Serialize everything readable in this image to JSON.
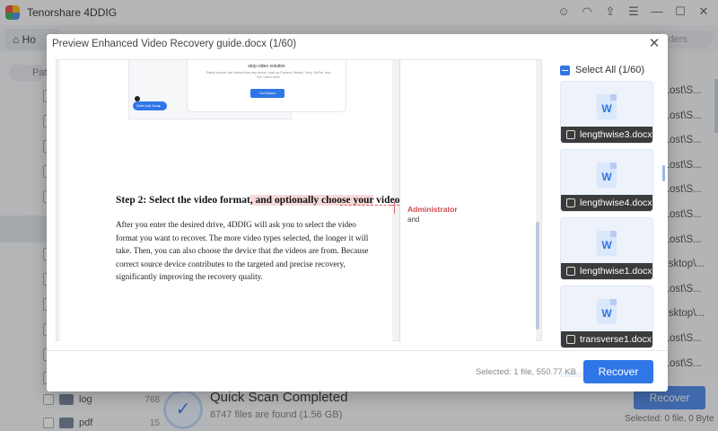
{
  "app": {
    "title": "Tenorshare 4DDIG",
    "home_tab": "Ho",
    "folders_placeholder": "iders",
    "path_chip": "Pat"
  },
  "background": {
    "right_column": [
      "h Lost\\S...",
      "h Lost\\S...",
      "h Lost\\S...",
      "h Lost\\S...",
      "h Lost\\S...",
      "h Lost\\S...",
      "h Lost\\S...",
      "Desktop\\...",
      "h Lost\\S...",
      "Desktop\\...",
      "h Lost\\S...",
      "h Lost\\S..."
    ],
    "tree": [
      {
        "name": "log",
        "count": "768"
      },
      {
        "name": "pdf",
        "count": "15"
      }
    ],
    "scan_title": "Quick Scan Completed",
    "scan_sub": "8747 files are found (1.56 GB)",
    "recover_label": "Recover",
    "selected_text": "Selected: 0 file, 0 Byte"
  },
  "modal": {
    "title": "Preview Enhanced Video Recovery guide.docx (1/60)",
    "doc": {
      "embed_title": "stop video solution",
      "embed_desc": "Easily recover lost videos from any device, such as Camera, Meiser, Sony, GoPro, and DJI. Learn more",
      "embed_button": "Get Started",
      "embed_pill": "Guide Quik Cam ▶",
      "heading_a": "Step 2: Select the video format",
      "heading_b": ", and optionally choose your",
      "heading_c": " video device.",
      "body": "After you enter the desired drive, 4DDIG will ask you to select the video format you want to recover. The more video types selected, the longer it will take. Then, you can also choose the device that the videos are from. Because correct source device contributes to the targeted and precise recovery, significantly improving the recovery quality.",
      "comment_author": "Administrator",
      "comment_text": "and"
    },
    "select_all": "Select All (1/60)",
    "thumbs": [
      {
        "name": "lengthwise3.docx"
      },
      {
        "name": "lengthwise4.docx"
      },
      {
        "name": "lengthwise1.docx"
      },
      {
        "name": "transverse1.docx"
      }
    ],
    "file_glyph": "W",
    "selected_text": "Selected: 1 file, 550.77 KB",
    "recover_label": "Recover"
  },
  "colors": {
    "accent": "#2f76e6",
    "comment": "#d14b4b",
    "highlight": "#f7d9d9"
  },
  "icons": {
    "titlebar": [
      "assistant-icon",
      "headset-icon",
      "share-icon",
      "menu-icon",
      "minimize-icon",
      "maximize-icon",
      "close-icon"
    ]
  }
}
